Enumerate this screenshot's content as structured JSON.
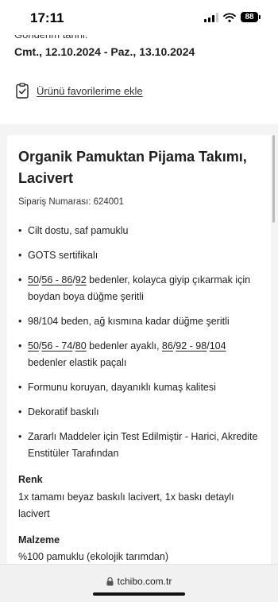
{
  "status": {
    "time": "17:11",
    "battery": "88"
  },
  "delivery": {
    "label": "Gönderim tarihi:",
    "dates": "Cmt., 12.10.2024 - Paz., 13.10.2024"
  },
  "favorite": {
    "label": "Ürünü favorilerime ekle",
    "icon": "clipboard-check-icon"
  },
  "product": {
    "title_line1": "Organik Pamuktan Pijama Takımı,",
    "title_line2": "Lacivert",
    "order_number": "Sipariş Numarası: 624001",
    "features": {
      "f1": "Cilt dostu, saf pamuklu",
      "f2": "GOTS sertifikalı",
      "f3": {
        "a": "50",
        "b": "56 - 86",
        "c": "92",
        "rest": " bedenler, kolayca giyip çıkarmak için boydan boya düğme şeritli"
      },
      "f4": "98/104 beden, ağ kısmına kadar düğme şeritli",
      "f5": {
        "a": "50",
        "b": "56 - 74",
        "c": "80",
        "mid": " bedenler ayaklı, ",
        "d": "86",
        "e": "92 - 98",
        "f": "104",
        "rest": " bedenler elastik paçalı"
      },
      "f6": "Formunu koruyan, dayanıklı kumaş kalitesi",
      "f7": "Dekoratif baskılı",
      "f8": "Zararlı Maddeler için Test Edilmiştir - Harici, Akredite Enstitüler Tarafından"
    },
    "color": {
      "heading": "Renk",
      "text": "1x tamamı beyaz baskılı lacivert, 1x baskı detaylı lacivert"
    },
    "material": {
      "heading": "Malzeme",
      "text": "%100 pamuklu (ekolojik tarımdan)"
    }
  },
  "browser": {
    "url": "tchibo.com.tr",
    "icon": "lock-icon"
  }
}
